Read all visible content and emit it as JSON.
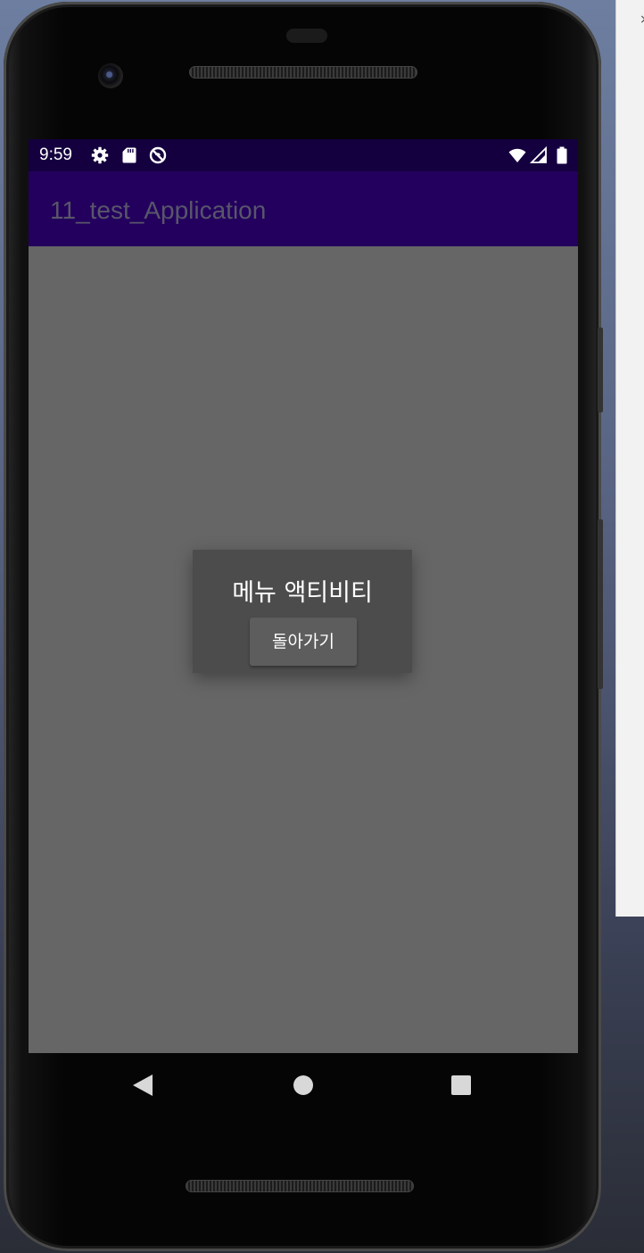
{
  "status_bar": {
    "time": "9:59",
    "left_icons": [
      "gear-icon",
      "sd-card-icon",
      "do-not-disturb-icon"
    ],
    "right_icons": [
      "wifi-icon",
      "cell-signal-icon",
      "battery-icon"
    ],
    "background": "#14003e"
  },
  "app_bar": {
    "title": "11_test_Application",
    "background": "#23005e",
    "title_color": "#58566a"
  },
  "dialog": {
    "title": "메뉴 액티비티",
    "button_label": "돌아가기",
    "background": "#4c4c4c"
  },
  "nav_bar": {
    "buttons": [
      "back-icon",
      "home-icon",
      "recents-icon"
    ]
  },
  "colors": {
    "screen_background": "#666666",
    "scrim": "#666666"
  }
}
